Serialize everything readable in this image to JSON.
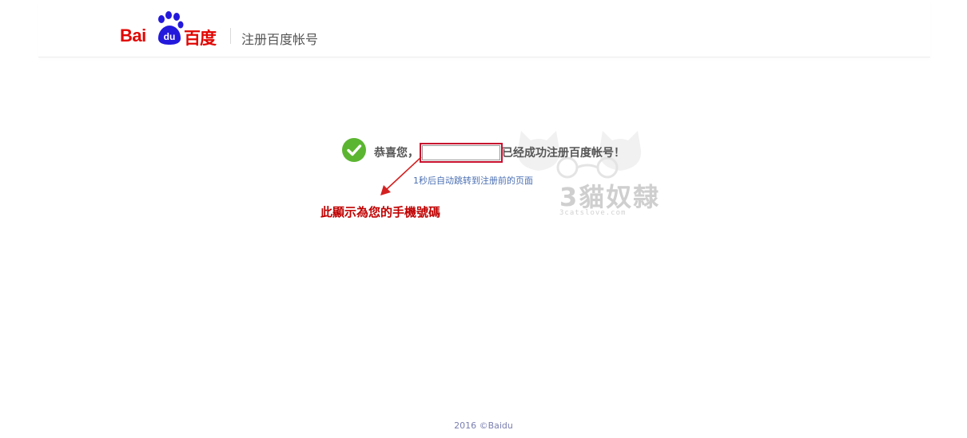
{
  "header": {
    "logo_latin": "Bai",
    "logo_du": "du",
    "logo_cn": "百度",
    "title": "注册百度帐号"
  },
  "success": {
    "greeting": "恭喜您，",
    "account_value": "",
    "message": "已经成功注册百度帐号！",
    "redirect_text": "1秒后自动跳转到注册前的页面"
  },
  "annotation": {
    "text": "此顯示為您的手機號碼"
  },
  "watermark": {
    "text": "3貓奴隸",
    "url": "3catslove.com"
  },
  "footer": {
    "copyright": "2016 ©Baidu"
  },
  "colors": {
    "brand_red": "#e10602",
    "paw_blue": "#2319dc",
    "success_green": "#5cb531",
    "annotation_red": "#c00000",
    "link_blue": "#4a6fb3"
  }
}
